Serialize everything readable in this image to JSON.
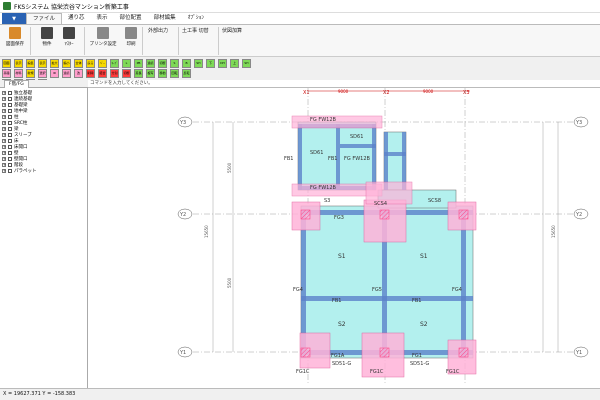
{
  "window": {
    "title": "FKSシステム  協栄渋谷マンション新築工事"
  },
  "menu": {
    "file_button": "▼",
    "tabs": [
      {
        "label": "ファイル",
        "active": true
      },
      {
        "label": "通り芯",
        "active": false
      },
      {
        "label": "表示",
        "active": false
      },
      {
        "label": "部位配置",
        "active": false
      },
      {
        "label": "部材編集",
        "active": false
      },
      {
        "label": "ｵﾌﾟｼｮﾝ",
        "active": false
      }
    ]
  },
  "ribbon": {
    "buttons": [
      {
        "label": "図面保存",
        "color": "#d98a2b"
      },
      {
        "label": "物件",
        "color": "#555555"
      },
      {
        "label": "ﾏｽﾀｰ",
        "color": "#555555"
      },
      {
        "label": "プリンタ設定",
        "color": "#777777"
      },
      {
        "label": "印刷",
        "color": "#777777"
      }
    ],
    "groups": [
      "外部出力",
      "土工事 切替",
      "伏図加算"
    ]
  },
  "toolbar": {
    "row1": [
      {
        "t": "図面移動",
        "c": "#f5d800"
      },
      {
        "t": "表示",
        "c": "#f5d800"
      },
      {
        "t": "編集",
        "c": "#f5d800"
      },
      {
        "t": "表示",
        "c": "#f5d800"
      },
      {
        "t": "拡大",
        "c": "#f5d800"
      },
      {
        "t": "縮小",
        "c": "#f5d800"
      },
      {
        "t": "全体",
        "c": "#f5d800"
      },
      {
        "t": "戻る",
        "c": "#f5d800"
      },
      {
        "t": "ﾍﾟｰｼﾞ",
        "c": "#f5d800"
      },
      {
        "t": "ｷｰﾌﾟ",
        "c": "#7ed957"
      },
      {
        "t": "L",
        "c": "#7ed957"
      },
      {
        "t": "PB",
        "c": "#7ed957"
      },
      {
        "t": "連続",
        "c": "#7ed957"
      },
      {
        "t": "切断",
        "c": "#7ed957"
      },
      {
        "t": "S",
        "c": "#7ed957"
      },
      {
        "t": "B",
        "c": "#7ed957"
      },
      {
        "t": "SH",
        "c": "#7ed957"
      },
      {
        "t": "下",
        "c": "#7ed957"
      },
      {
        "t": "DH",
        "c": "#7ed957"
      },
      {
        "t": "上",
        "c": "#7ed957"
      },
      {
        "t": "SH",
        "c": "#7ed957"
      }
    ],
    "row2": [
      {
        "t": "基礎",
        "c": "#ff9ecb"
      },
      {
        "t": "材料",
        "c": "#ff9ecb"
      },
      {
        "t": "新規",
        "c": "#f5d800"
      },
      {
        "t": "選択",
        "c": "#ff9ecb"
      },
      {
        "t": "ID",
        "c": "#ff9ecb"
      },
      {
        "t": "連続",
        "c": "#ff9ecb"
      },
      {
        "t": "改",
        "c": "#ff9ecb"
      },
      {
        "t": "削除",
        "c": "#ff3b3b"
      },
      {
        "t": "結合",
        "c": "#ff3b3b"
      },
      {
        "t": "分割",
        "c": "#ff3b3b"
      },
      {
        "t": "切断",
        "c": "#ff3b3b"
      },
      {
        "t": "延長",
        "c": "#7ed957"
      },
      {
        "t": "複写",
        "c": "#7ed957"
      },
      {
        "t": "移動",
        "c": "#7ed957"
      },
      {
        "t": "回転",
        "c": "#7ed957"
      },
      {
        "t": "反転",
        "c": "#7ed957"
      }
    ],
    "row3": [
      {
        "t": "属性",
        "c": "#ff9ecb"
      },
      {
        "t": "表示",
        "c": "#ff9ecb"
      },
      {
        "t": "設定",
        "c": "#ff9ecb"
      },
      {
        "t": "ｺﾋﾟｰ",
        "c": "#ffffff"
      }
    ]
  },
  "left_panel": {
    "tab": "F階/FG",
    "tree": [
      "独立基礎",
      "連続基礎",
      "基礎梁",
      "地中梁",
      "柱",
      "SRC柱",
      "梁",
      "スリーブ",
      "床",
      "床開口",
      "壁",
      "壁開口",
      "階段",
      "パラペット"
    ]
  },
  "command_prompt": "コマンドを入力してください。",
  "drawing": {
    "grid_x": [
      "X1",
      "X2",
      "X3"
    ],
    "grid_y": [
      "Y1",
      "Y2",
      "Y3"
    ],
    "spans_x": [
      "9000",
      "9000"
    ],
    "spans_y": [
      "5500",
      "5500"
    ],
    "total_y": "15650",
    "labels": {
      "fb": "FB1",
      "sd": "SD61",
      "sd2": "SD51-G",
      "fg3": "FG3",
      "fg4": "FG4",
      "fg5": "FG5",
      "fb1": "FB1",
      "fg1a": "FG1A",
      "fg1b": "FG1",
      "fg1c": "FG1C",
      "s1": "S1",
      "s2": "S2",
      "s3": "S3",
      "s4": "SCS8",
      "s5": "SCS4",
      "fg_top": "FG FW12B"
    },
    "colors": {
      "slab": "#b3f0ee",
      "beam": "#5b82c9",
      "column": "#ffb3d9",
      "hatch": "#ff4a8a",
      "dimline": "#cc0000"
    }
  },
  "status": {
    "coord_text": "X = 19627.371 Y = -158.383"
  }
}
